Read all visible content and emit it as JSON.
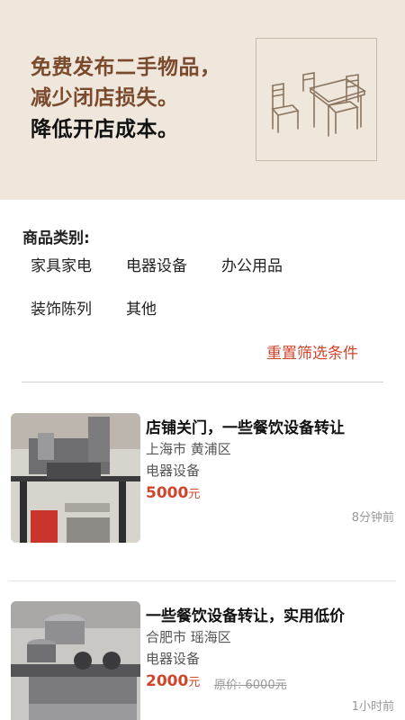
{
  "banner": {
    "line1": "免费发布二手物品，",
    "line2": "减少闭店损失。",
    "line3": "降低开店成本。",
    "image_icon": "dining-furniture-icon"
  },
  "filters": {
    "title": "商品类别:",
    "categories": [
      "家具家电",
      "电器设备",
      "办公用品",
      "装饰陈列",
      "其他"
    ],
    "reset_label": "重置筛选条件"
  },
  "listings": [
    {
      "title": "店铺关门，一些餐饮设备转让",
      "location": "上海市 黄浦区",
      "category": "电器设备",
      "price": "5000",
      "price_unit": "元",
      "original_price": "",
      "time": "8分钟前"
    },
    {
      "title": "一些餐饮设备转让，实用低价",
      "location": "合肥市 瑶海区",
      "category": "电器设备",
      "price": "2000",
      "price_unit": "元",
      "original_price": "原价: 6000元",
      "time": "1小时前"
    }
  ],
  "colors": {
    "banner_bg": "#efe6dc",
    "brand_brown": "#7a4a2c",
    "accent_red": "#d0452c"
  }
}
